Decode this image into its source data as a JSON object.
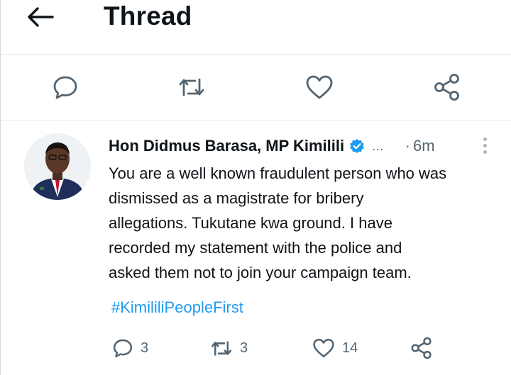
{
  "header": {
    "title": "Thread"
  },
  "action_bar": {
    "icons": [
      "reply-icon",
      "retweet-icon",
      "like-icon",
      "share-icon"
    ]
  },
  "tweet": {
    "author": "Hon Didmus Barasa, MP Kimilili",
    "handle_truncated": "...",
    "dot": "·",
    "time": "6m",
    "body_lines": [
      "You are a well known fraudulent person who was",
      "dismissed as a magistrate for bribery",
      "allegations. Tukutane kwa ground. I have",
      "recorded my statement with the police and",
      "asked them not to join your campaign team."
    ],
    "hashtag": "#KimililiPeopleFirst",
    "stats": {
      "replies": "3",
      "retweets": "3",
      "likes": "14"
    }
  },
  "colors": {
    "accent": "#1d9bf0",
    "verified": "#1d9bf0",
    "muted": "#536471",
    "text": "#0f1419"
  }
}
